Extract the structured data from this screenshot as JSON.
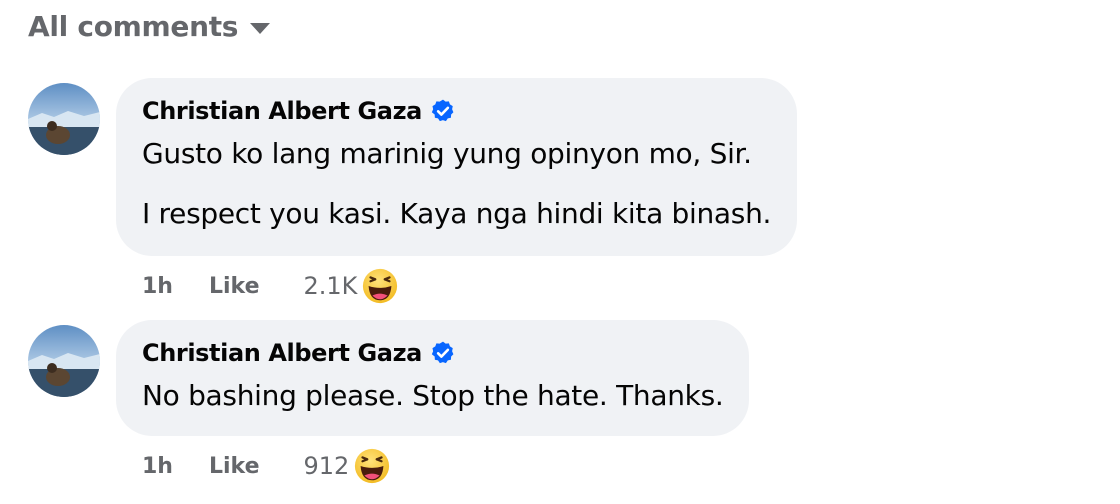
{
  "filter": {
    "label": "All comments",
    "icon": "caret-down-icon"
  },
  "comments": [
    {
      "author": "Christian Albert Gaza",
      "verified": true,
      "paragraphs": [
        "Gusto ko lang marinig yung opinyon mo, Sir.",
        "I respect you kasi. Kaya nga hindi kita binash."
      ],
      "time": "1h",
      "like_label": "Like",
      "reaction_count": "2.1K",
      "reaction_icon": "haha-emoji-icon"
    },
    {
      "author": "Christian Albert Gaza",
      "verified": true,
      "paragraphs": [
        "No bashing please. Stop the hate. Thanks."
      ],
      "time": "1h",
      "like_label": "Like",
      "reaction_count": "912",
      "reaction_icon": "haha-emoji-icon"
    }
  ],
  "colors": {
    "bubble": "#f0f2f5",
    "secondary_text": "#65676b",
    "verified_badge": "#0866ff",
    "emoji_face": "#f7c53c"
  }
}
